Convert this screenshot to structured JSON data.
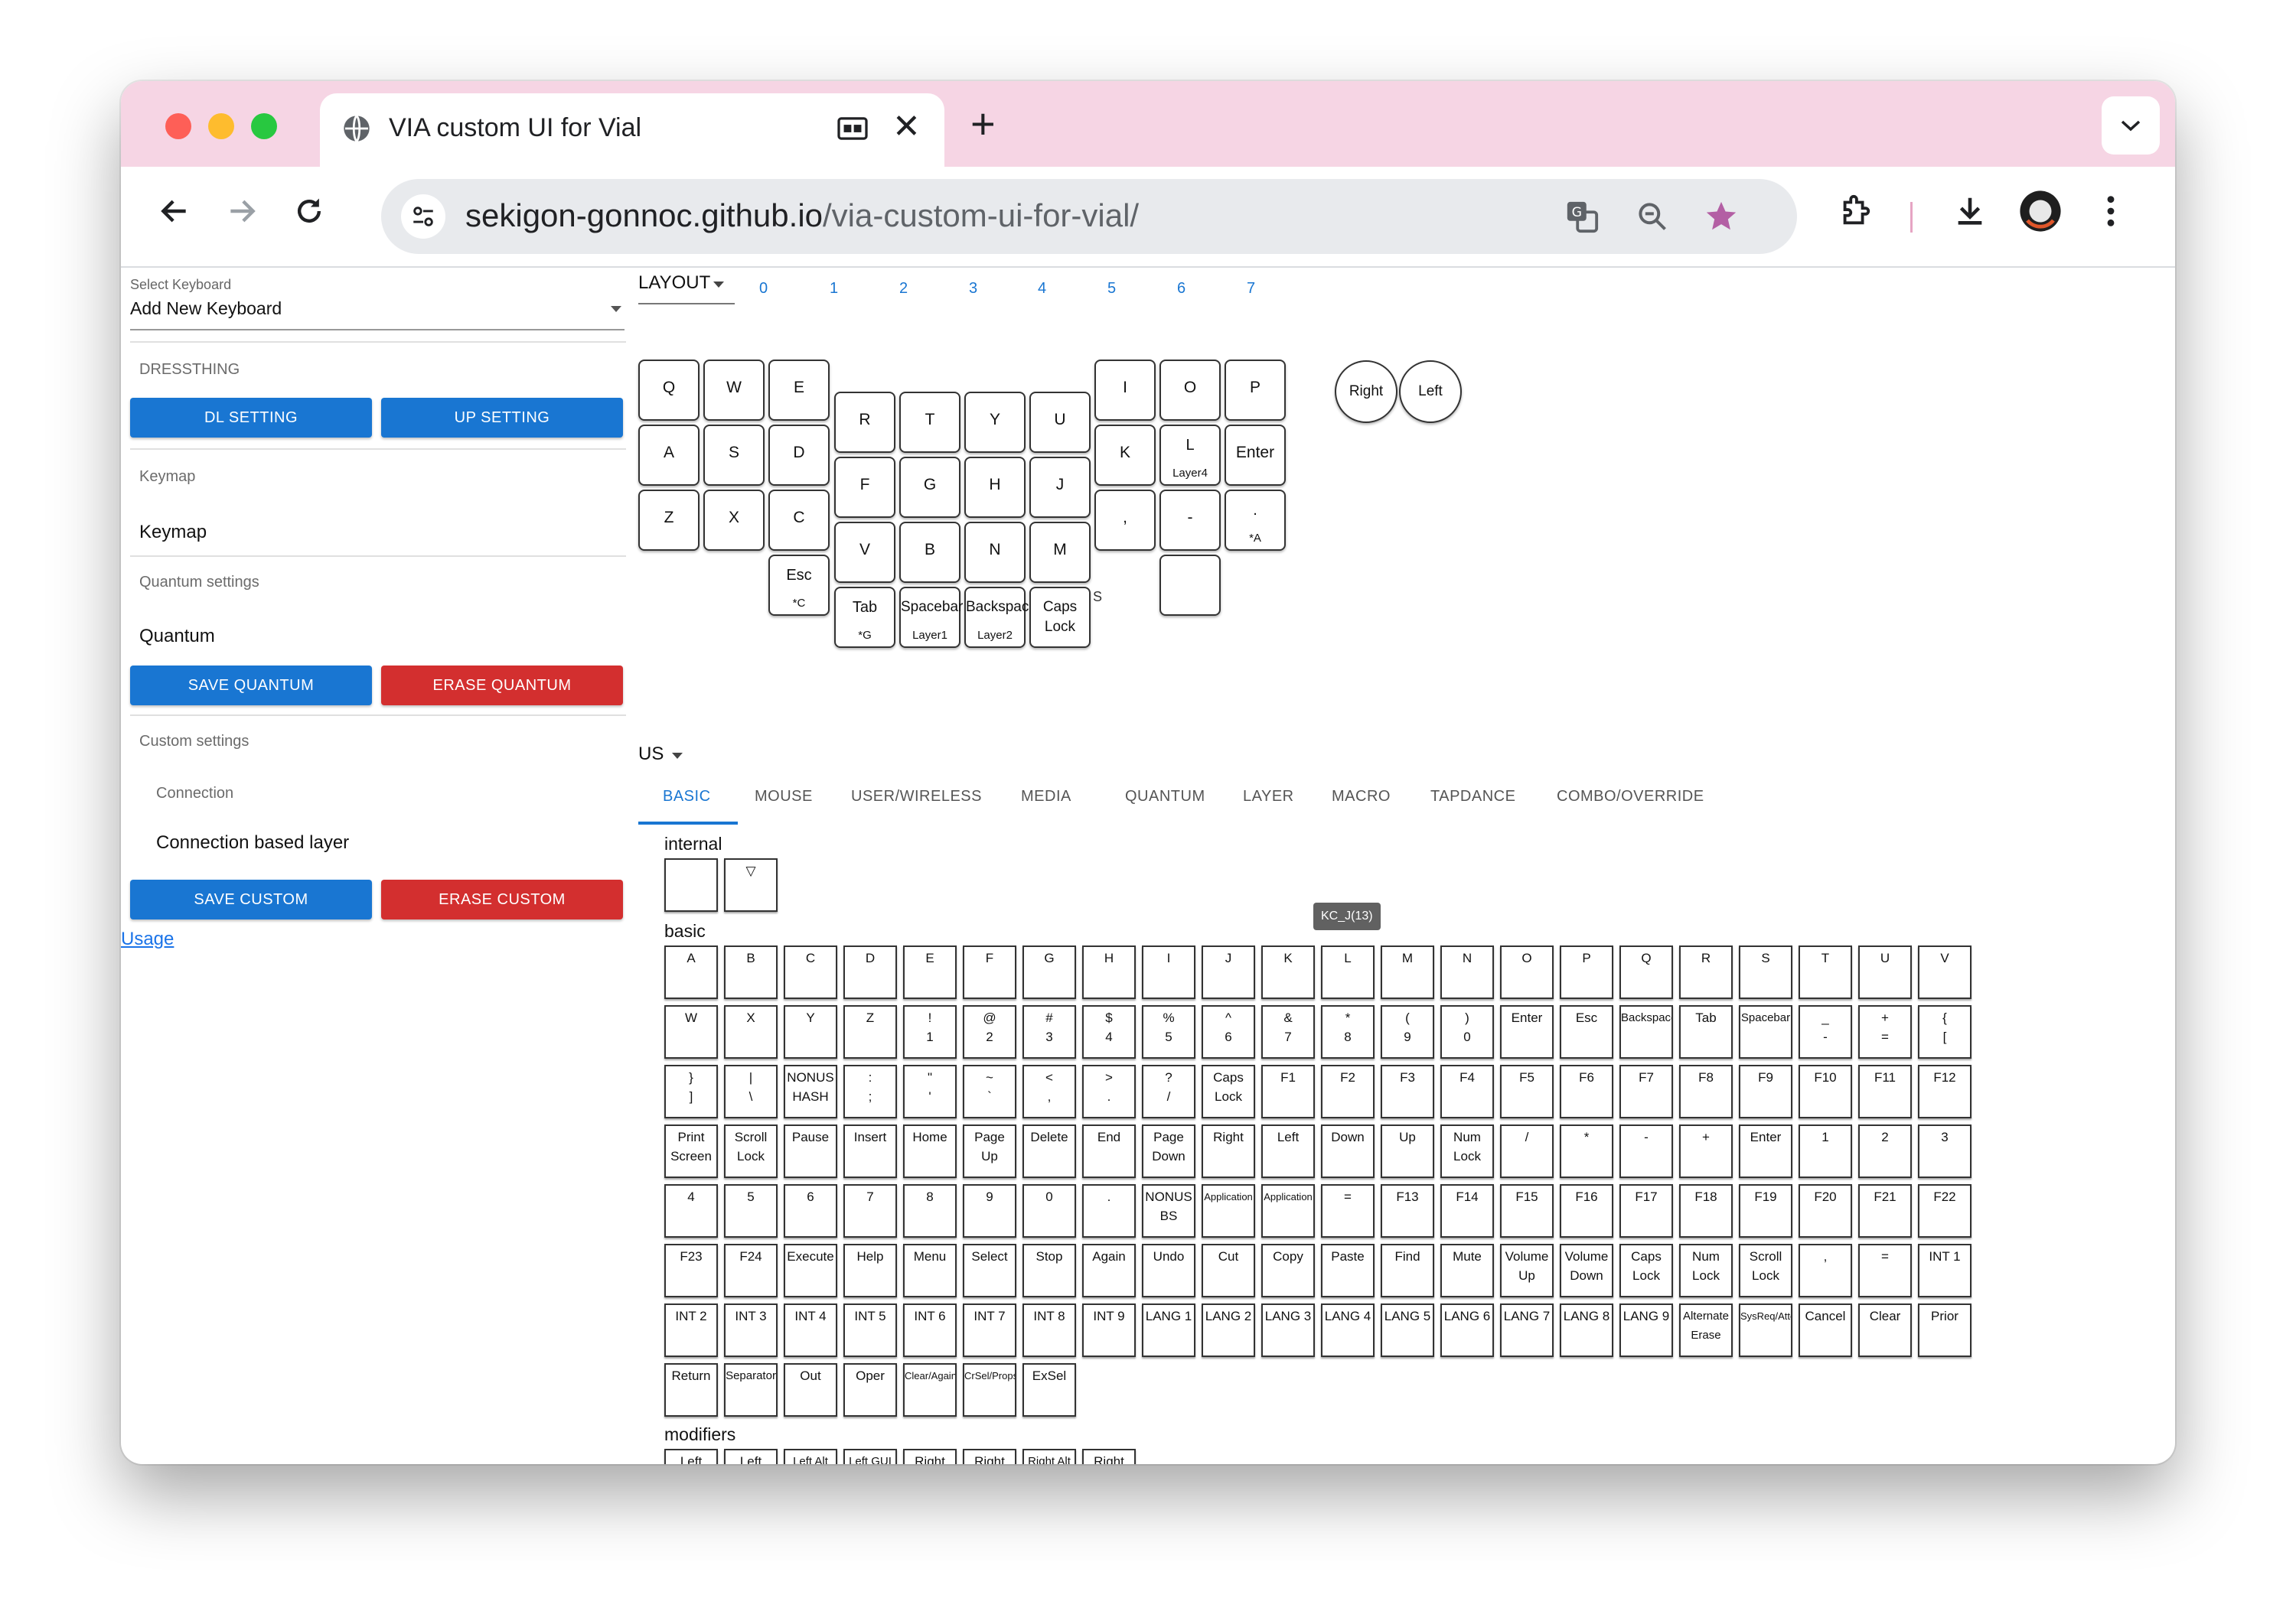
{
  "browser": {
    "tab_title": "VIA custom UI for Vial",
    "url_host": "sekigon-gonnoc.github.io",
    "url_path": "/via-custom-ui-for-vial/"
  },
  "sidebar": {
    "select_label": "Select Keyboard",
    "select_value": "Add New Keyboard",
    "device_name": "DRESSTHING",
    "dl_button": "DL SETTING",
    "up_button": "UP SETTING",
    "keymap_section": "Keymap",
    "keymap_item": "Keymap",
    "quantum_section": "Quantum settings",
    "quantum_item": "Quantum",
    "save_quantum": "SAVE QUANTUM",
    "erase_quantum": "ERASE QUANTUM",
    "custom_section": "Custom settings",
    "connection_section": "Connection",
    "connection_item": "Connection based layer",
    "save_custom": "SAVE CUSTOM",
    "erase_custom": "ERASE CUSTOM",
    "usage_link": "Usage"
  },
  "layout": {
    "label": "LAYOUT",
    "layers": [
      "0",
      "1",
      "2",
      "3",
      "4",
      "5",
      "6",
      "7"
    ]
  },
  "keyboard": {
    "keys": [
      {
        "main": "Q",
        "sub": ""
      },
      {
        "main": "W",
        "sub": ""
      },
      {
        "main": "E",
        "sub": ""
      },
      {
        "main": "R",
        "sub": ""
      },
      {
        "main": "T",
        "sub": ""
      },
      {
        "main": "Y",
        "sub": ""
      },
      {
        "main": "U",
        "sub": ""
      },
      {
        "main": "I",
        "sub": ""
      },
      {
        "main": "O",
        "sub": ""
      },
      {
        "main": "P",
        "sub": ""
      },
      {
        "main": "A",
        "sub": ""
      },
      {
        "main": "S",
        "sub": ""
      },
      {
        "main": "D",
        "sub": ""
      },
      {
        "main": "F",
        "sub": ""
      },
      {
        "main": "G",
        "sub": ""
      },
      {
        "main": "H",
        "sub": ""
      },
      {
        "main": "J",
        "sub": ""
      },
      {
        "main": "K",
        "sub": ""
      },
      {
        "main": "L",
        "sub": "Layer4"
      },
      {
        "main": "Enter",
        "sub": ""
      },
      {
        "main": "Z",
        "sub": ""
      },
      {
        "main": "X",
        "sub": ""
      },
      {
        "main": "C",
        "sub": ""
      },
      {
        "main": "V",
        "sub": ""
      },
      {
        "main": "B",
        "sub": ""
      },
      {
        "main": "N",
        "sub": ""
      },
      {
        "main": "M",
        "sub": ""
      },
      {
        "main": ",",
        "sub": ""
      },
      {
        "main": "-",
        "sub": ""
      },
      {
        "main": ".",
        "sub": "*A"
      },
      {
        "main": "Esc",
        "sub": "*C"
      },
      {
        "main": "Tab",
        "sub": "*G"
      },
      {
        "main": "Spacebar",
        "sub": "Layer1"
      },
      {
        "main": "Backspace",
        "sub": "Layer2"
      },
      {
        "main": "Caps\nLock",
        "sub": ""
      },
      {
        "main": "",
        "sub": ""
      }
    ],
    "stray_text": "S",
    "encoders": [
      "Right",
      "Left"
    ]
  },
  "lang": "US",
  "categories": [
    "BASIC",
    "MOUSE",
    "USER/WIRELESS",
    "MEDIA",
    "QUANTUM",
    "LAYER",
    "MACRO",
    "TAPDANCE",
    "COMBO/OVERRIDE"
  ],
  "tooltip": "KC_J(13)",
  "groups": {
    "internal": {
      "title": "internal",
      "keys": [
        "",
        "▽"
      ]
    },
    "basic": {
      "title": "basic",
      "rows": [
        [
          "A",
          "B",
          "C",
          "D",
          "E",
          "F",
          "G",
          "H",
          "I",
          "J",
          "K",
          "L",
          "M",
          "N",
          "O",
          "P",
          "Q",
          "R",
          "S",
          "T",
          "U",
          "V"
        ],
        [
          "W",
          "X",
          "Y",
          "Z",
          "!\n1",
          "@\n2",
          "#\n3",
          "$\n4",
          "%\n5",
          "^\n6",
          "&\n7",
          "*\n8",
          "(\n9",
          ")\n0",
          "Enter",
          "Esc",
          "Backspace",
          "Tab",
          "Spacebar",
          "_\n-",
          "+\n=",
          "{\n["
        ],
        [
          "}\n]",
          "|\n\\",
          "NONUS\nHASH",
          ":\n;",
          "\"\n'",
          "~\n`",
          "<\n,",
          ">\n.",
          "?\n/",
          "Caps\nLock",
          "F1",
          "F2",
          "F3",
          "F4",
          "F5",
          "F6",
          "F7",
          "F8",
          "F9",
          "F10",
          "F11",
          "F12"
        ],
        [
          "Print\nScreen",
          "Scroll\nLock",
          "Pause",
          "Insert",
          "Home",
          "Page\nUp",
          "Delete",
          "End",
          "Page\nDown",
          "Right",
          "Left",
          "Down",
          "Up",
          "Num\nLock",
          "/",
          "*",
          "-",
          "+",
          "Enter",
          "1",
          "2",
          "3"
        ],
        [
          "4",
          "5",
          "6",
          "7",
          "8",
          "9",
          "0",
          ".",
          "NONUS\nBS",
          "Application",
          "Application",
          "=",
          "F13",
          "F14",
          "F15",
          "F16",
          "F17",
          "F18",
          "F19",
          "F20",
          "F21",
          "F22"
        ],
        [
          "F23",
          "F24",
          "Execute",
          "Help",
          "Menu",
          "Select",
          "Stop",
          "Again",
          "Undo",
          "Cut",
          "Copy",
          "Paste",
          "Find",
          "Mute",
          "Volume\nUp",
          "Volume\nDown",
          "Caps\nLock",
          "Num\nLock",
          "Scroll\nLock",
          ",",
          "=",
          "INT 1"
        ],
        [
          "INT 2",
          "INT 3",
          "INT 4",
          "INT 5",
          "INT 6",
          "INT 7",
          "INT 8",
          "INT 9",
          "LANG 1",
          "LANG 2",
          "LANG 3",
          "LANG 4",
          "LANG 5",
          "LANG 6",
          "LANG 7",
          "LANG 8",
          "LANG 9",
          "Alternate\nErase",
          "SysReq/Attention",
          "Cancel",
          "Clear",
          "Prior"
        ],
        [
          "Return",
          "Separator",
          "Out",
          "Oper",
          "Clear/Again",
          "CrSel/Props",
          "ExSel"
        ]
      ]
    },
    "modifiers": {
      "title": "modifiers",
      "keys": [
        "Left\nControl",
        "Left\nShift",
        "Left Alt",
        "Left GUI",
        "Right\nControl",
        "Right\nShift",
        "Right Alt",
        "Right\nGUI"
      ]
    }
  }
}
